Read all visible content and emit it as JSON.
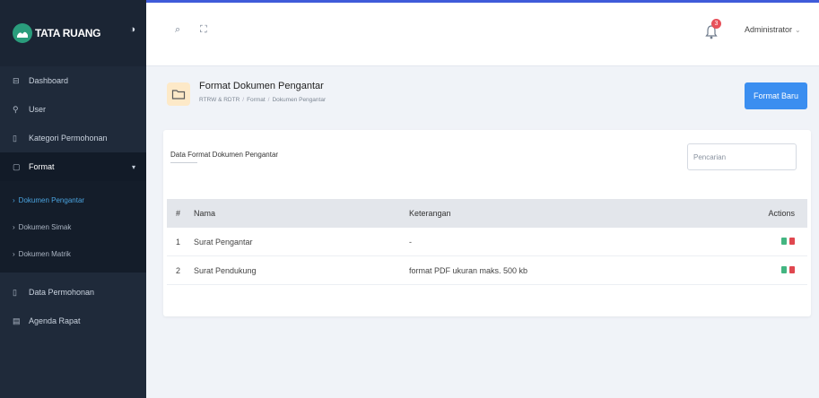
{
  "brand": {
    "name": "TATA RUANG"
  },
  "sidebar": {
    "items": [
      {
        "label": "Dashboard",
        "icon": "dashboard-icon"
      },
      {
        "label": "User",
        "icon": "user-icon"
      },
      {
        "label": "Kategori Permohonan",
        "icon": "category-icon"
      },
      {
        "label": "Format",
        "icon": "format-icon"
      },
      {
        "label": "Data Permohonan",
        "icon": "data-icon"
      },
      {
        "label": "Agenda Rapat",
        "icon": "calendar-icon"
      }
    ],
    "submenu": [
      {
        "label": "Dokumen Pengantar",
        "active": true
      },
      {
        "label": "Dokumen Simak",
        "active": false
      },
      {
        "label": "Dokumen Matrik",
        "active": false
      }
    ]
  },
  "topbar": {
    "notification_count": "3",
    "user_name": "Administrator"
  },
  "page": {
    "title": "Format Dokumen Pengantar",
    "breadcrumb": [
      "RTRW & RDTR",
      "Format",
      "Dokumen Pengantar"
    ],
    "new_button": "Format Baru"
  },
  "card": {
    "title": "Data Format Dokumen Pengantar",
    "search_placeholder": "Pencarian"
  },
  "table": {
    "headers": {
      "no": "#",
      "name": "Nama",
      "ket": "Keterangan",
      "actions": "Actions"
    },
    "rows": [
      {
        "no": "1",
        "name": "Surat Pengantar",
        "ket": "-"
      },
      {
        "no": "2",
        "name": "Surat Pendukung",
        "ket": "format PDF ukuran maks. 500 kb"
      }
    ]
  },
  "colors": {
    "sidebar": "#1f2a3a",
    "accent": "#3b8ef0",
    "topbar_border": "#3f5bd9",
    "edit": "#43b581",
    "delete": "#e0474f"
  }
}
